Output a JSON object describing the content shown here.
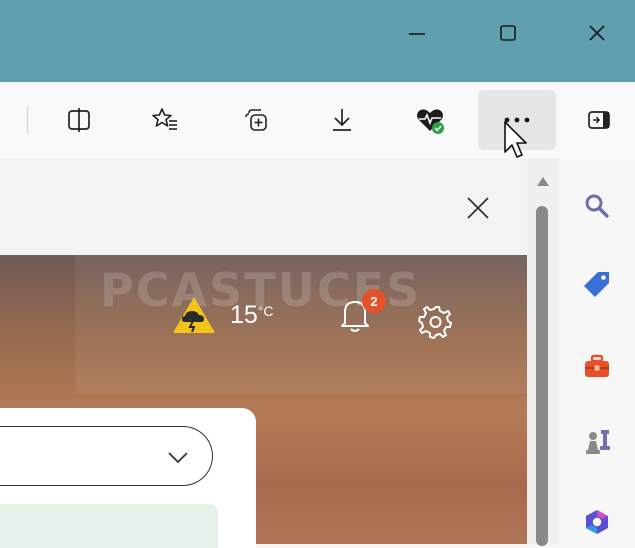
{
  "window": {
    "buttons": [
      {
        "name": "minimize-icon",
        "label": "—"
      },
      {
        "name": "maximize-icon",
        "label": "☐"
      },
      {
        "name": "close-icon",
        "label": "✕"
      }
    ]
  },
  "toolbar": {
    "items": [
      {
        "name": "split-screen-icon"
      },
      {
        "name": "favorites-icon"
      },
      {
        "name": "collections-icon"
      },
      {
        "name": "downloads-icon"
      },
      {
        "name": "browser-essentials-icon"
      },
      {
        "name": "more-menu-icon"
      },
      {
        "name": "sidebar-toggle-icon"
      }
    ]
  },
  "newtab": {
    "weather": {
      "temp": "15",
      "unit": "°C",
      "icon": "weather-cloud-lightning-icon"
    },
    "notifications": {
      "count": "2"
    },
    "settings_icon": "gear-icon",
    "watermark": "PCASTUCES"
  },
  "sidebar": {
    "items": [
      {
        "name": "search-icon",
        "color": "#7a7aa0"
      },
      {
        "name": "shopping-tag-icon",
        "color": "#3a6fd8"
      },
      {
        "name": "tools-icon",
        "color": "#e8502c"
      },
      {
        "name": "games-icon",
        "color": "#8a8a8a"
      },
      {
        "name": "office-icon",
        "color": "#5a4fd0"
      }
    ]
  },
  "colors": {
    "titlebar": "#5f9fae",
    "badge": "#e5512b",
    "weather_icon": "#f2c31b"
  }
}
